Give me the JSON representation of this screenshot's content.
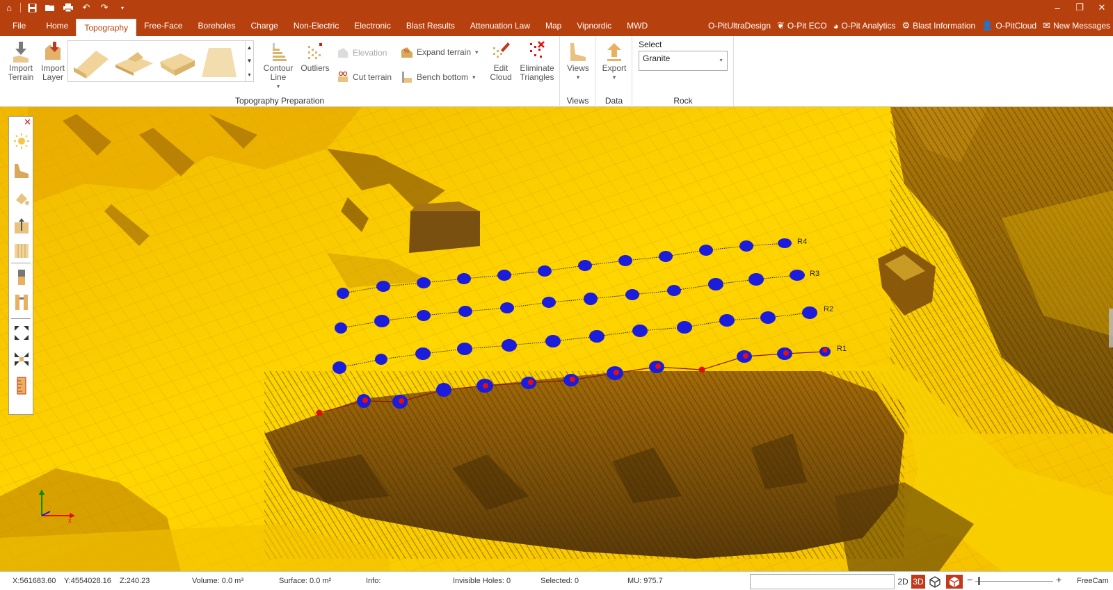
{
  "titlebar": {
    "quick_access": [
      "app-icon",
      "save-icon",
      "open-icon",
      "print-icon",
      "undo-icon",
      "redo-icon",
      "customize-icon"
    ],
    "window_controls": [
      "minimize-icon",
      "restore-icon",
      "close-icon"
    ]
  },
  "menu": {
    "tabs": [
      "File",
      "Home",
      "Topography",
      "Free-Face",
      "Boreholes",
      "Charge",
      "Non-Electric",
      "Electronic",
      "Blast Results",
      "Attenuation Law",
      "Map",
      "Vipnordic",
      "MWD"
    ],
    "active_tab": "Topography",
    "links": [
      {
        "label": "O-PitUltraDesign",
        "icon": ""
      },
      {
        "label": "O-Pit ECO",
        "icon": "leaf-icon"
      },
      {
        "label": "O-Pit Analytics",
        "icon": "pie-chart-icon"
      },
      {
        "label": "Blast Information",
        "icon": "gear-icon"
      },
      {
        "label": "O-PitCloud",
        "icon": "user-icon"
      },
      {
        "label": "New Messages",
        "icon": "mail-icon"
      }
    ]
  },
  "ribbon": {
    "import_terrain": "Import Terrain",
    "import_layer": "Import Layer",
    "contour_line": "Contour Line",
    "outliers": "Outliers",
    "elevation": "Elevation",
    "cut_terrain": "Cut terrain",
    "expand_terrain": "Expand terrain",
    "bench_bottom": "Bench bottom",
    "edit_cloud": "Edit Cloud",
    "eliminate_triangles": "Eliminate Triangles",
    "group_topography": "Topography Preparation",
    "views": "Views",
    "group_views": "Views",
    "export": "Export",
    "group_data": "Data",
    "select_label": "Select",
    "rock_value": "Granite",
    "group_rock": "Rock"
  },
  "viewport": {
    "row_labels": [
      "R4",
      "R3",
      "R2",
      "R1"
    ],
    "colors": {
      "hole": "#1c1cdc",
      "hole_marker": "#e01010",
      "terrain": "#f5c400",
      "shadow": "#8a5a0a"
    }
  },
  "statusbar": {
    "x": "X:561683.60",
    "y": "Y:4554028.16",
    "z": "Z:240.23",
    "volume": "Volume: 0.0 m³",
    "surface": "Surface: 0.0 m²",
    "info": "Info:",
    "invisible_holes": "Invisible Holes: 0",
    "selected": "Selected: 0",
    "mu": "MU: 975.7",
    "mode_2d": "2D",
    "mode_3d": "3D",
    "camera": "FreeCam"
  }
}
